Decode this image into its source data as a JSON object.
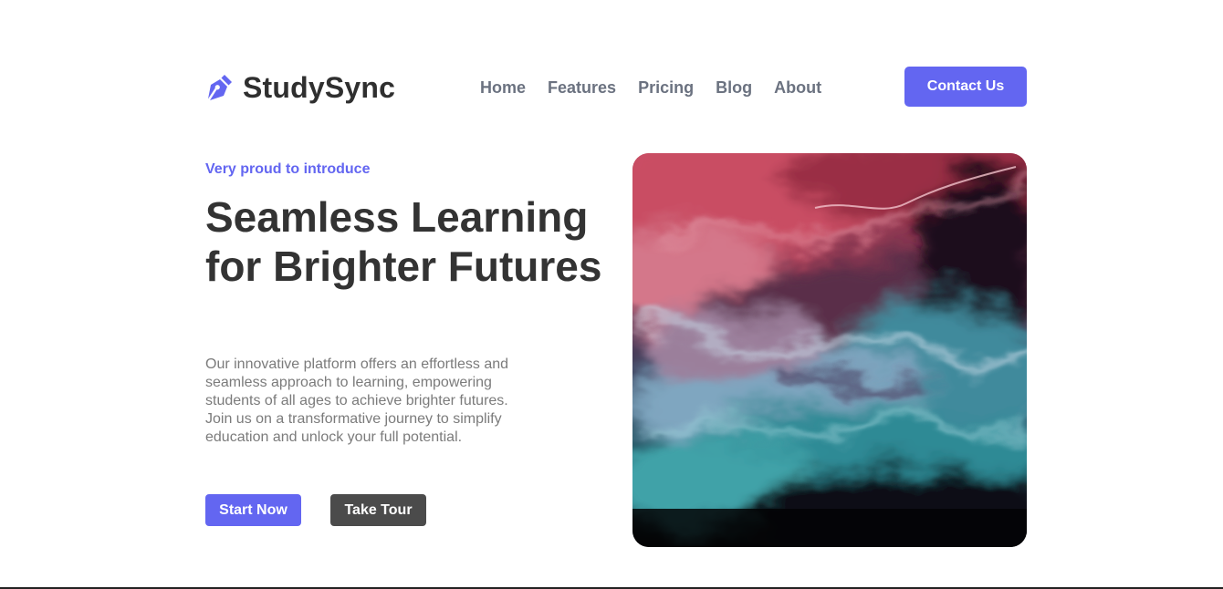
{
  "brand": {
    "name": "StudySync",
    "icon": "pen-nib-icon",
    "accent_color": "#6366f1"
  },
  "nav": {
    "items": [
      {
        "label": "Home"
      },
      {
        "label": "Features"
      },
      {
        "label": "Pricing"
      },
      {
        "label": "Blog"
      },
      {
        "label": "About"
      }
    ]
  },
  "header": {
    "contact_label": "Contact Us"
  },
  "hero": {
    "eyebrow": "Very proud to introduce",
    "headline": "Seamless Learning for Brighter Futures",
    "description": "Our innovative platform offers an effortless and seamless approach to learning, empowering students of all ages to achieve brighter futures. Join us on a transformative journey to simplify education and unlock your full potential.",
    "primary_button": "Start Now",
    "secondary_button": "Take Tour"
  }
}
